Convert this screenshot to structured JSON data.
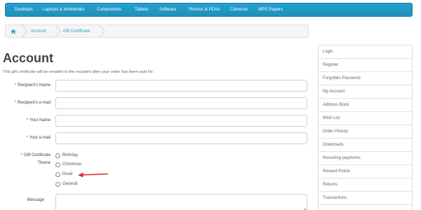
{
  "topnav": {
    "items": [
      "Desktops",
      "Laptops & Notebooks",
      "Components",
      "Tablets",
      "Software",
      "Phones & PDAs",
      "Cameras",
      "MP3 Players"
    ]
  },
  "breadcrumb": {
    "items": [
      "Account",
      "Gift Certificate"
    ]
  },
  "page": {
    "title": "Account",
    "intro": "This gift certificate will be emailed to the recipient after your order has been paid for."
  },
  "form": {
    "required_mark": "*",
    "recipient_name_label": "Recipient's Name",
    "recipient_email_label": "Recipient's e-mail",
    "your_name_label": "Your Name",
    "your_email_label": "Your e-mail",
    "theme_label_line1": "Gift Certificate",
    "theme_label_line2": "Theme",
    "themes": [
      "Birthday",
      "Christmas",
      "Divali",
      "General"
    ],
    "message_label": "Message",
    "recipient_name_value": "",
    "recipient_email_value": "",
    "your_name_value": "",
    "your_email_value": "",
    "message_value": ""
  },
  "annotation": {
    "arrow_color": "#d9302c"
  },
  "sidebar": {
    "items": [
      "Login",
      "Register",
      "Forgotten Password",
      "My Account",
      "Address Book",
      "Wish List",
      "Order History",
      "Downloads",
      "Recurring payments",
      "Reward Points",
      "Returns",
      "Transactions"
    ]
  },
  "colors": {
    "nav_bg": "#229ac8",
    "link": "#23a1d1",
    "required": "#e01a1a"
  }
}
